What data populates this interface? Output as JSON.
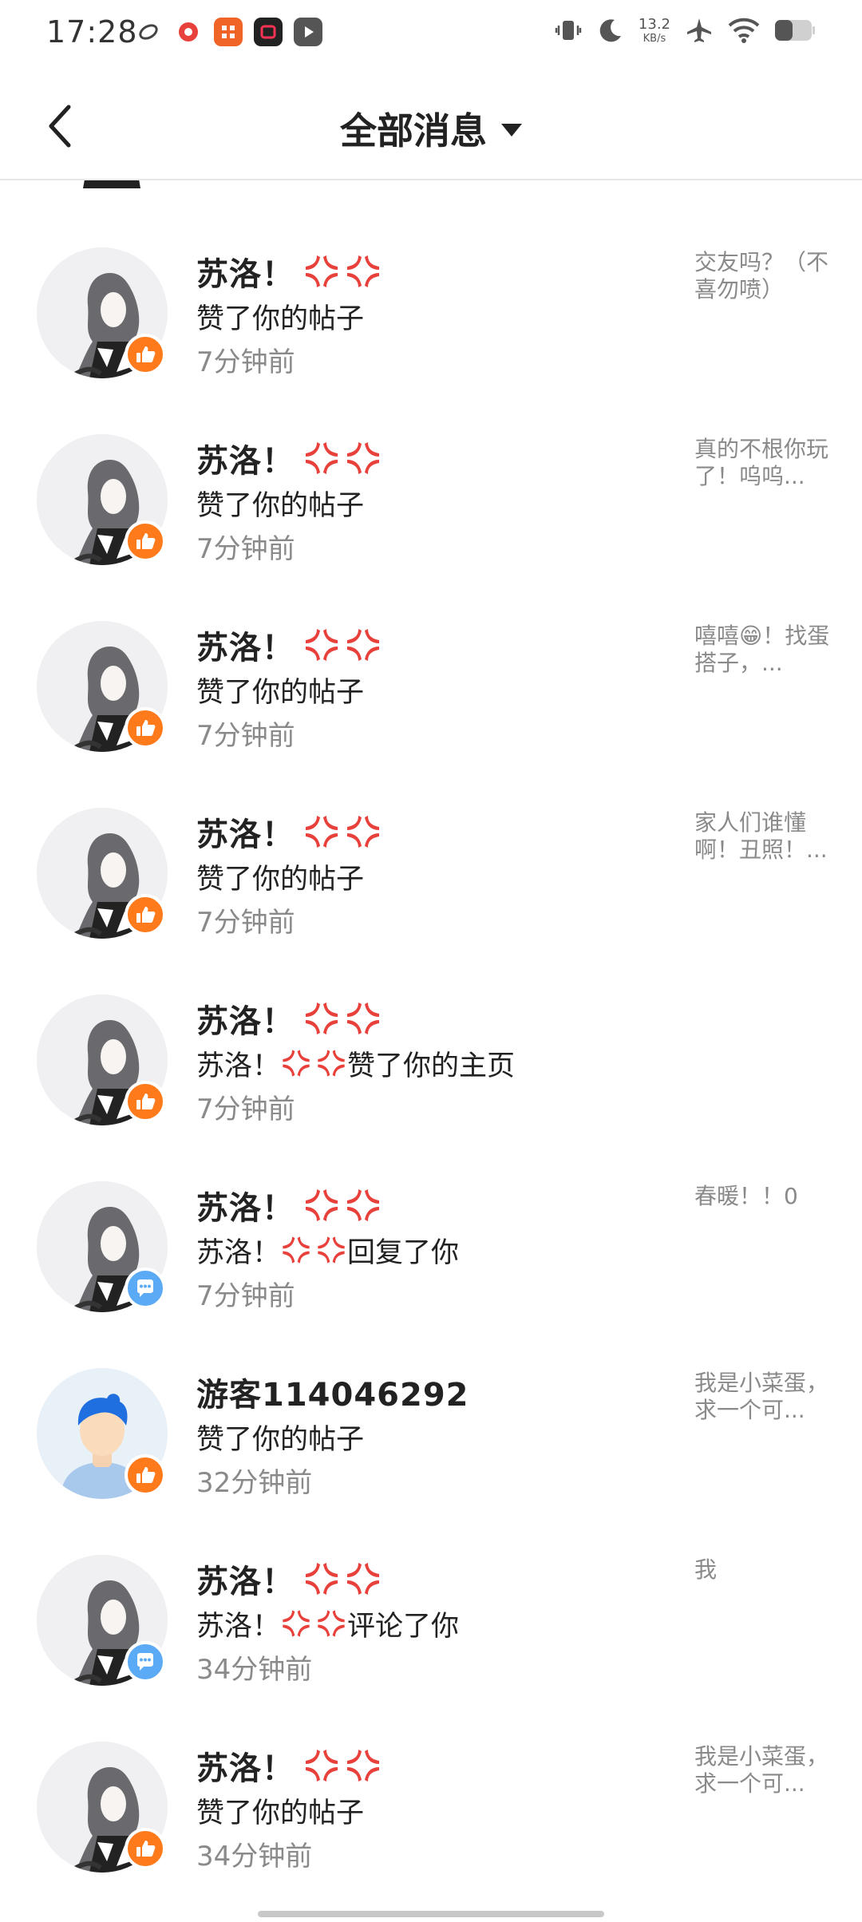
{
  "status_bar": {
    "time": "17:28",
    "net_speed_value": "13.2",
    "net_speed_unit": "KB/s",
    "notification_icons": [
      "tiktok-lite-icon",
      "netease-music-icon",
      "app-grid-icon",
      "video-app-icon",
      "play-store-icon"
    ],
    "system_icons": [
      "vibrate-icon",
      "do-not-disturb-icon",
      "airplane-mode-icon",
      "wifi-icon",
      "battery-icon"
    ]
  },
  "header": {
    "title": "全部消息"
  },
  "colors": {
    "like_badge": "#ff7a1a",
    "comment_badge": "#5aaaf5",
    "anger_emoji": "#e8403a"
  },
  "messages": [
    {
      "name": "苏洛！",
      "name_emoji": true,
      "action_prefix": "",
      "action_emoji": false,
      "action": "赞了你的帖子",
      "time": "7分钟前",
      "preview": "交友吗？（不喜勿喷）",
      "badge": "like",
      "avatar": "girl"
    },
    {
      "name": "苏洛！",
      "name_emoji": true,
      "action_prefix": "",
      "action_emoji": false,
      "action": "赞了你的帖子",
      "time": "7分钟前",
      "preview": "真的不根你玩了！呜呜...",
      "badge": "like",
      "avatar": "girl"
    },
    {
      "name": "苏洛！",
      "name_emoji": true,
      "action_prefix": "",
      "action_emoji": false,
      "action": "赞了你的帖子",
      "time": "7分钟前",
      "preview": "嘻嘻😁！找蛋搭子，...",
      "badge": "like",
      "avatar": "girl"
    },
    {
      "name": "苏洛！",
      "name_emoji": true,
      "action_prefix": "",
      "action_emoji": false,
      "action": "赞了你的帖子",
      "time": "7分钟前",
      "preview": "家人们谁懂啊！丑照！...",
      "badge": "like",
      "avatar": "girl"
    },
    {
      "name": "苏洛！",
      "name_emoji": true,
      "action_prefix": "苏洛！",
      "action_emoji": true,
      "action": "赞了你的主页",
      "time": "7分钟前",
      "preview": "",
      "badge": "like",
      "avatar": "girl"
    },
    {
      "name": "苏洛！",
      "name_emoji": true,
      "action_prefix": "苏洛！",
      "action_emoji": true,
      "action": "回复了你",
      "time": "7分钟前",
      "preview": "春暖！！0",
      "badge": "comment",
      "avatar": "girl"
    },
    {
      "name": "游客114046292",
      "name_emoji": false,
      "action_prefix": "",
      "action_emoji": false,
      "action": "赞了你的帖子",
      "time": "32分钟前",
      "preview": "我是小菜蛋，求一个可...",
      "badge": "like",
      "avatar": "guest"
    },
    {
      "name": "苏洛！",
      "name_emoji": true,
      "action_prefix": "苏洛！",
      "action_emoji": true,
      "action": "评论了你",
      "time": "34分钟前",
      "preview": "我",
      "badge": "comment",
      "avatar": "girl"
    },
    {
      "name": "苏洛！",
      "name_emoji": true,
      "action_prefix": "",
      "action_emoji": false,
      "action": "赞了你的帖子",
      "time": "34分钟前",
      "preview": "我是小菜蛋，求一个可...",
      "badge": "like",
      "avatar": "girl"
    }
  ]
}
